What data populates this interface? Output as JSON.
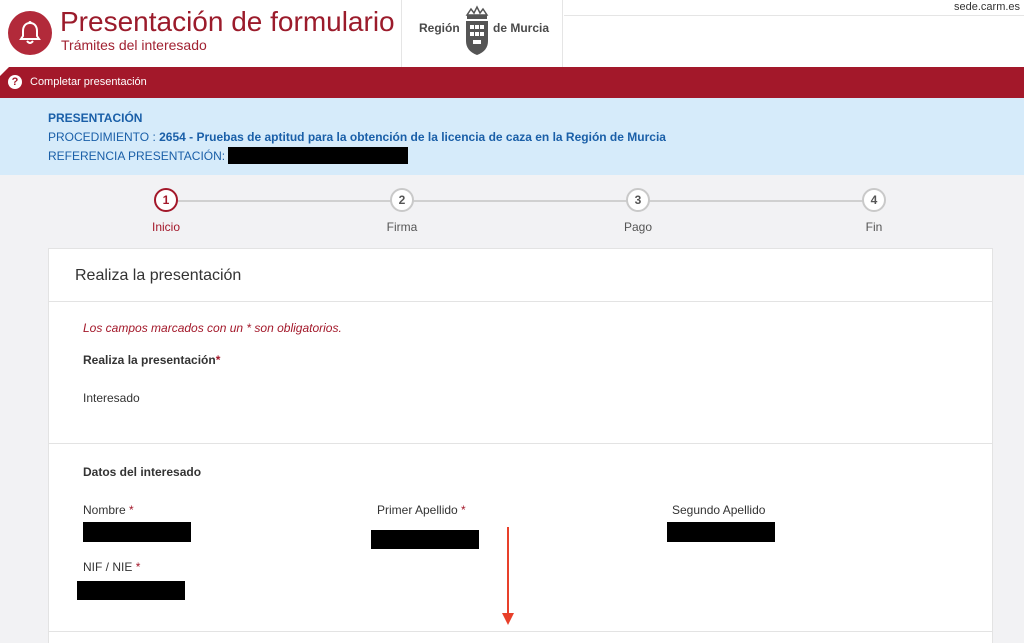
{
  "header": {
    "title": "Presentación de formulario",
    "subtitle": "Trámites del interesado",
    "region_left": "Región",
    "region_right": "de Murcia",
    "url": "sede.carm.es",
    "logo_icon": "bell-icon",
    "brand_color": "#a3182a"
  },
  "toolbar": {
    "help_icon": "?",
    "label": "Completar presentación"
  },
  "info": {
    "title": "PRESENTACIÓN",
    "procedure_label": "PROCEDIMIENTO : ",
    "procedure_value": "2654 - Pruebas de aptitud para la obtención de la licencia de caza en la Región de Murcia",
    "reference_label": "REFERENCIA PRESENTACIÓN:"
  },
  "steps": [
    {
      "number": "1",
      "label": "Inicio",
      "active": true
    },
    {
      "number": "2",
      "label": "Firma",
      "active": false
    },
    {
      "number": "3",
      "label": "Pago",
      "active": false
    },
    {
      "number": "4",
      "label": "Fin",
      "active": false
    }
  ],
  "form": {
    "card_title": "Realiza la presentación",
    "required_note": "Los campos marcados con un * son obligatorios.",
    "presentation_label": "Realiza la presentación",
    "presentation_value": "Interesado",
    "section_title": "Datos del interesado",
    "required_marker": "*",
    "fields": {
      "nombre": "Nombre",
      "primer_apellido": "Primer Apellido",
      "segundo_apellido": "Segundo Apellido",
      "nif": "NIF / NIE"
    }
  }
}
